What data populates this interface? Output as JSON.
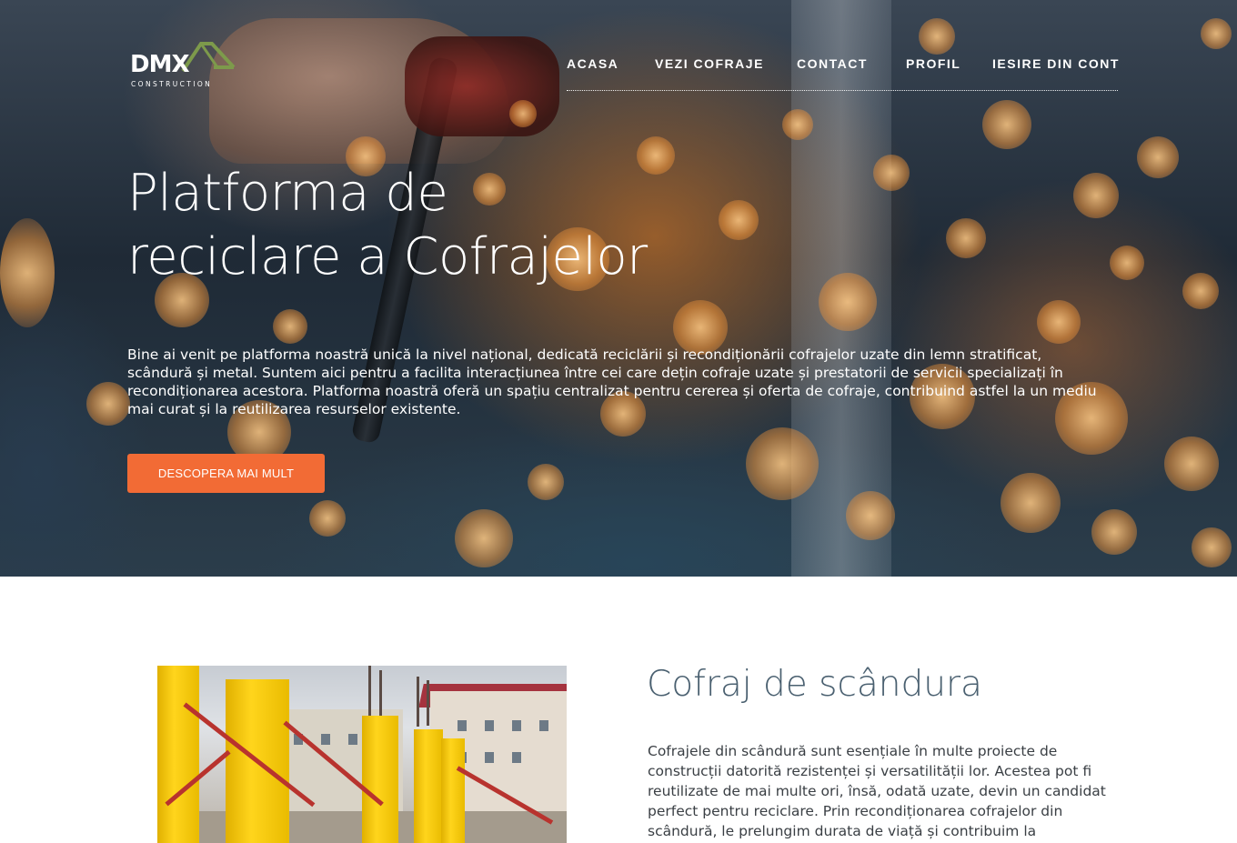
{
  "brand": {
    "logo_text": "DMX",
    "logo_subtext": "CONSTRUCTION"
  },
  "nav": {
    "items": [
      {
        "label": "ACASA"
      },
      {
        "label": "VEZI COFRAJE"
      },
      {
        "label": "CONTACT"
      },
      {
        "label": "PROFIL"
      },
      {
        "label": "IESIRE DIN CONT"
      }
    ]
  },
  "hero": {
    "title_line1": "Platforma de",
    "title_line2": "reciclare a Cofrajelor",
    "description": "Bine ai venit pe platforma noastră unică la nivel național, dedicată reciclării și recondiționării cofrajelor uzate din lemn stratificat, scândură și metal. Suntem aici pentru a facilita interacțiunea între cei care dețin cofraje uzate și prestatorii de servicii specializați în recondiționarea acestora. Platforma noastră oferă un spațiu centralizat pentru cererea și oferta de cofraje, contribuind astfel la un mediu mai curat și la reutilizarea resurselor existente.",
    "button_label": "DESCOPERA MAI MULT"
  },
  "section": {
    "title": "Cofraj de scândura",
    "text": "Cofrajele din scândură sunt esențiale în multe proiecte de construcții datorită rezistenței și versatilității lor. Acestea pot fi reutilizate de mai multe ori, însă, odată uzate, devin un candidat perfect pentru reciclare. Prin recondiționarea cofrajelor din scândură, le prelungim durata de viață și contribuim la"
  },
  "colors": {
    "accent": "#f26b35",
    "heading": "#4a6070",
    "logo_green": "#7d9a4b"
  }
}
